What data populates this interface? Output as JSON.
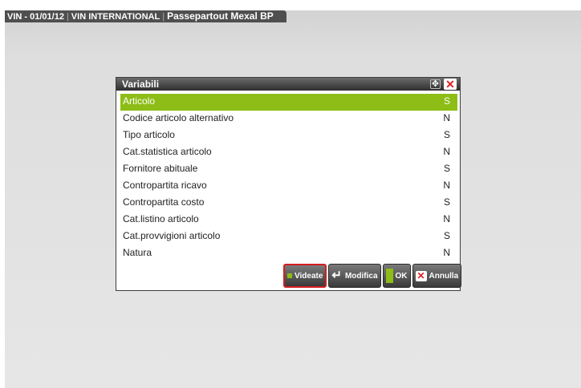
{
  "window": {
    "title_code": "VIN - 01/01/12",
    "company": "VIN INTERNATIONAL",
    "product": "Passepartout Mexal BP"
  },
  "dialog": {
    "title": "Variabili",
    "move_glyph": "✥",
    "close_glyph": "✕",
    "rows": [
      {
        "label": "Articolo",
        "value": "S",
        "selected": true
      },
      {
        "label": "Codice articolo alternativo",
        "value": "N"
      },
      {
        "label": "Tipo articolo",
        "value": "S"
      },
      {
        "label": "Cat.statistica articolo",
        "value": "N"
      },
      {
        "label": "Fornitore abituale",
        "value": "S"
      },
      {
        "label": "Contropartita ricavo",
        "value": "N"
      },
      {
        "label": "Contropartita costo",
        "value": "S"
      },
      {
        "label": "Cat.listino articolo",
        "value": "N"
      },
      {
        "label": "Cat.provvigioni articolo",
        "value": "S"
      },
      {
        "label": "Natura",
        "value": "N"
      }
    ],
    "buttons": {
      "videate": "Videate",
      "modifica": "Modifica",
      "ok": "OK",
      "annulla": "Annulla"
    }
  },
  "colors": {
    "accent_green": "#8dbd16",
    "focus_red": "#d51d1d",
    "close_red": "#e02020"
  },
  "icons": {
    "move": "move-icon",
    "close": "close-icon",
    "videate": "green-square-icon",
    "modifica": "enter-key-icon",
    "ok": "green-bar-icon",
    "annulla": "red-x-icon"
  }
}
